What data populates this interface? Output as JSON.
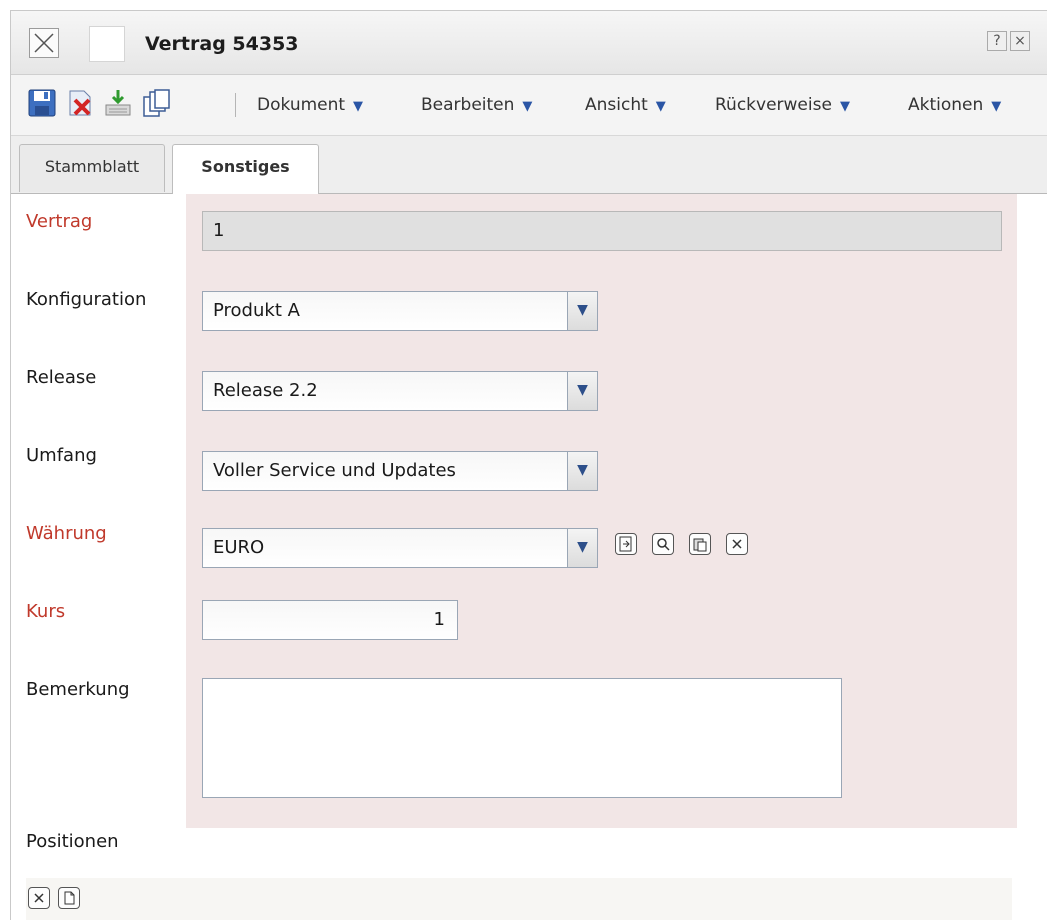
{
  "window": {
    "title": "Vertrag 54353",
    "help_label": "?",
    "close_label": "×"
  },
  "toolbar": {
    "menus": [
      {
        "label": "Dokument"
      },
      {
        "label": "Bearbeiten"
      },
      {
        "label": "Ansicht"
      },
      {
        "label": "Rückverweise"
      },
      {
        "label": "Aktionen"
      }
    ],
    "arrow": "▼",
    "icons": [
      "save-icon",
      "delete-icon",
      "import-icon",
      "copy-icon"
    ]
  },
  "tabs": [
    {
      "label": "Stammblatt",
      "active": false
    },
    {
      "label": "Sonstiges",
      "active": true
    }
  ],
  "form": {
    "vertrag": {
      "label": "Vertrag",
      "value": "1",
      "required": true
    },
    "konfiguration": {
      "label": "Konfiguration",
      "value": "Produkt A"
    },
    "release": {
      "label": "Release",
      "value": "Release 2.2"
    },
    "umfang": {
      "label": "Umfang",
      "value": "Voller Service und Updates"
    },
    "waehrung": {
      "label": "Währung",
      "value": "EURO",
      "required": true
    },
    "kurs": {
      "label": "Kurs",
      "value": "1",
      "required": true
    },
    "bemerkung": {
      "label": "Bemerkung",
      "value": ""
    },
    "positionen": {
      "label": "Positionen"
    }
  },
  "colors": {
    "required_label": "#c0392b",
    "form_background": "#f2e6e6",
    "menu_arrow": "#2a55a5"
  }
}
